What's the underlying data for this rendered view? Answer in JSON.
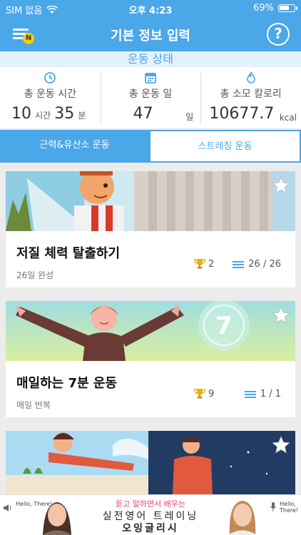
{
  "status_bar": {
    "carrier": "SIM 없음",
    "time": "오후 4:23",
    "battery": "69%",
    "battery_level": 0.69
  },
  "nav": {
    "title": "기본 정보 입력",
    "menu_badge": "N",
    "help": "?"
  },
  "section_title": "운동 상태",
  "stats": {
    "time": {
      "label": "총 운동 시간",
      "hours": "10",
      "hours_unit": "시간",
      "minutes": "35",
      "minutes_unit": "분"
    },
    "days": {
      "label": "총 운동 일",
      "value": "47",
      "unit": "일"
    },
    "calories": {
      "label": "총 소모 칼로리",
      "value": "10677.7",
      "unit": "kcal"
    }
  },
  "tabs": [
    {
      "label": "근력&유산소 운동",
      "active": true
    },
    {
      "label": "스트레칭 운동",
      "active": false
    }
  ],
  "programs": [
    {
      "title": "저질 체력 탈출하기",
      "subtitle": "26일 완성",
      "trophies": "2",
      "progress": "26 / 26"
    },
    {
      "title": "매일하는 7분 운동",
      "subtitle": "매일 반복",
      "trophies": "9",
      "progress": "1 / 1",
      "badge": "7"
    },
    {
      "title": "",
      "subtitle": ""
    }
  ],
  "banner": {
    "line1": "듣고 말하면서 배우는",
    "line2": "실전영어 트레이닝",
    "line3": "오잉글리시",
    "hello_left": "Hello, There!",
    "hello_right": "Hello, There!"
  },
  "colors": {
    "primary": "#4aa7e8",
    "accent": "#e0447a"
  }
}
